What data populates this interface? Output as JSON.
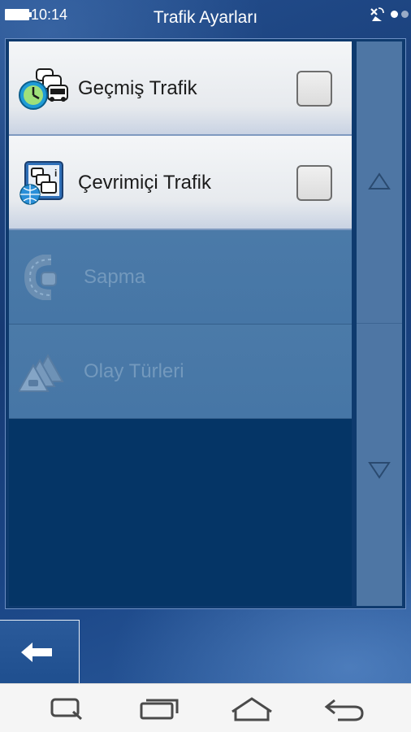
{
  "status_bar": {
    "time": "10:14",
    "icons": [
      "battery-icon",
      "gps-icon",
      "status-dot-icon",
      "status-dot-icon"
    ]
  },
  "header": {
    "title": "Trafik Ayarları"
  },
  "settings_list": [
    {
      "label": "Geçmiş Trafik",
      "icon": "historical-traffic-icon",
      "enabled": true,
      "checked": false
    },
    {
      "label": "Çevrimiçi Trafik",
      "icon": "online-traffic-icon",
      "enabled": true,
      "checked": false
    },
    {
      "label": "Sapma",
      "icon": "detour-icon",
      "enabled": false
    },
    {
      "label": "Olay Türleri",
      "icon": "event-types-icon",
      "enabled": false
    }
  ],
  "scrollbar": {
    "up_icon": "arrow-up-icon",
    "down_icon": "arrow-down-icon"
  },
  "footer": {
    "back_icon": "back-arrow-icon"
  },
  "system_nav": {
    "icons": [
      "search-icon",
      "recent-apps-icon",
      "home-icon",
      "back-icon"
    ]
  },
  "colors": {
    "background": "#1c3f7c",
    "row_enabled": "#e7eaee",
    "row_disabled": "#4676a6",
    "list_empty": "#053566",
    "scrollbar": "#4e76a4"
  }
}
